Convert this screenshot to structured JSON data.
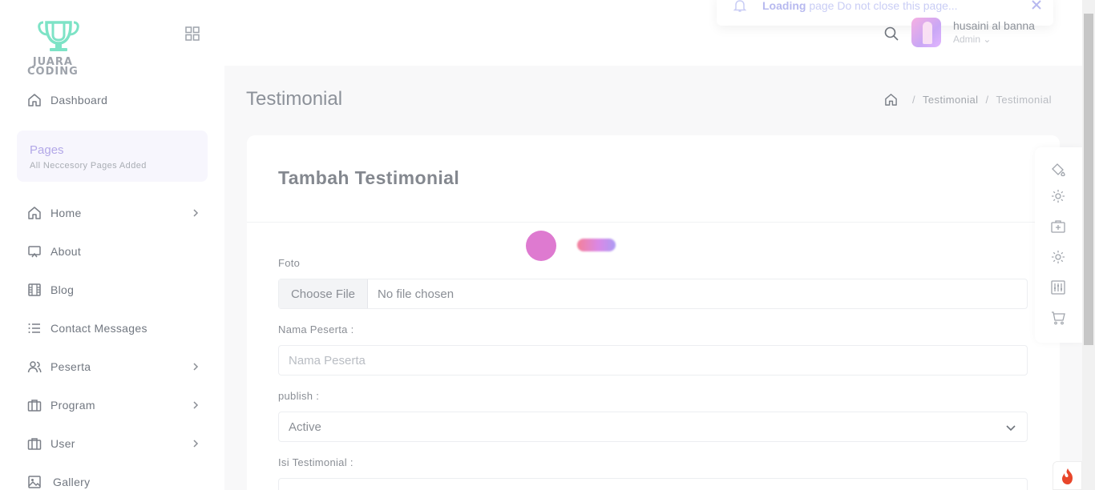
{
  "brand": {
    "logo_line1": "JUARA",
    "logo_line2": "CODING"
  },
  "sidebar": {
    "items": [
      {
        "label": "Dashboard",
        "icon": "home-icon"
      },
      {
        "label": "Home",
        "icon": "home-icon",
        "chevron": true
      },
      {
        "label": "About",
        "icon": "monitor-icon"
      },
      {
        "label": "Blog",
        "icon": "film-icon"
      },
      {
        "label": "Contact Messages",
        "icon": "list-icon"
      },
      {
        "label": "Peserta",
        "icon": "users-icon",
        "chevron": true
      },
      {
        "label": "Program",
        "icon": "briefcase-icon",
        "chevron": true
      },
      {
        "label": "User",
        "icon": "briefcase-icon",
        "chevron": true
      },
      {
        "label": "Gallery",
        "icon": "image-icon"
      }
    ],
    "pages_box": {
      "title": "Pages",
      "subtitle": "All Neccesory Pages Added"
    }
  },
  "toast": {
    "strong": "Loading",
    "text": " page Do not close this page..."
  },
  "user": {
    "name": "husaini al banna",
    "role": "Admin"
  },
  "page": {
    "title": "Testimonial"
  },
  "breadcrumb": {
    "items": [
      "Testimonial",
      "Testimonial"
    ]
  },
  "form": {
    "title": "Tambah Testimonial",
    "foto_label": "Foto",
    "file_button": "Choose File",
    "file_status": "No file chosen",
    "nama_label": "Nama Peserta :",
    "nama_placeholder": "Nama Peserta",
    "publish_label": "publish :",
    "publish_value": "Active",
    "isi_label": "Isi Testimonial :"
  },
  "colors": {
    "accent": "#b3a8e8",
    "logo": "#7de3c6",
    "loader_dot": "#de7ad0",
    "fire": "#e8462a"
  }
}
